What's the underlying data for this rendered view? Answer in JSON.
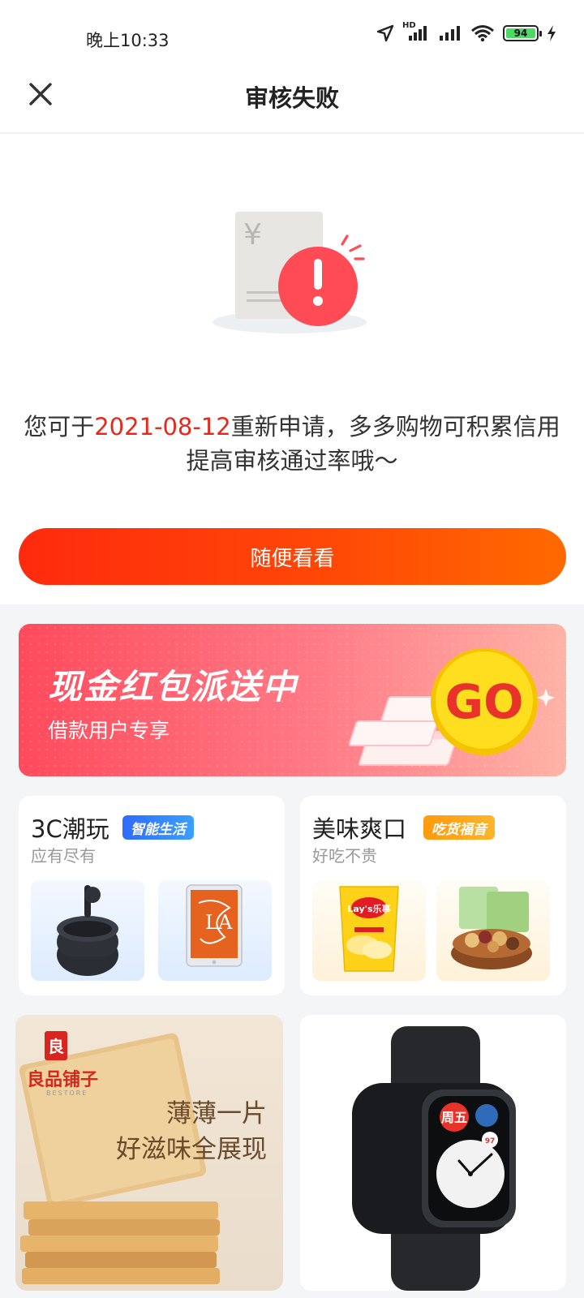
{
  "status_bar": {
    "time": "晚上10:33",
    "battery": "94",
    "network_label": "HD"
  },
  "nav": {
    "title": "审核失败"
  },
  "result": {
    "message_prefix": "您可于",
    "date": "2021-08-12",
    "message_suffix": "重新申请，多多购物可积累信用提高审核通过率哦～",
    "button_label": "随便看看"
  },
  "banner": {
    "title": "现金红包派送中",
    "subtitle": "借款用户专享",
    "go_label": "GO"
  },
  "categories": [
    {
      "title": "3C潮玩",
      "tag": "智能生活",
      "subtitle": "应有尽有"
    },
    {
      "title": "美味爽口",
      "tag": "吃货福音",
      "subtitle": "好吃不贵"
    }
  ],
  "products": {
    "snack_brand": "良品铺子",
    "snack_brand_en": "BESTORE",
    "snack_ad_line1": "薄薄一片",
    "snack_ad_line2": "好滋味全展现",
    "chips_brand": "Lay's乐事",
    "watch_day": "周五",
    "watch_heart": "97"
  },
  "colors": {
    "accent": "#ff3a0a",
    "date_red": "#e8281b",
    "tag_blue": "#2f6bff",
    "tag_orange": "#ffa515"
  }
}
